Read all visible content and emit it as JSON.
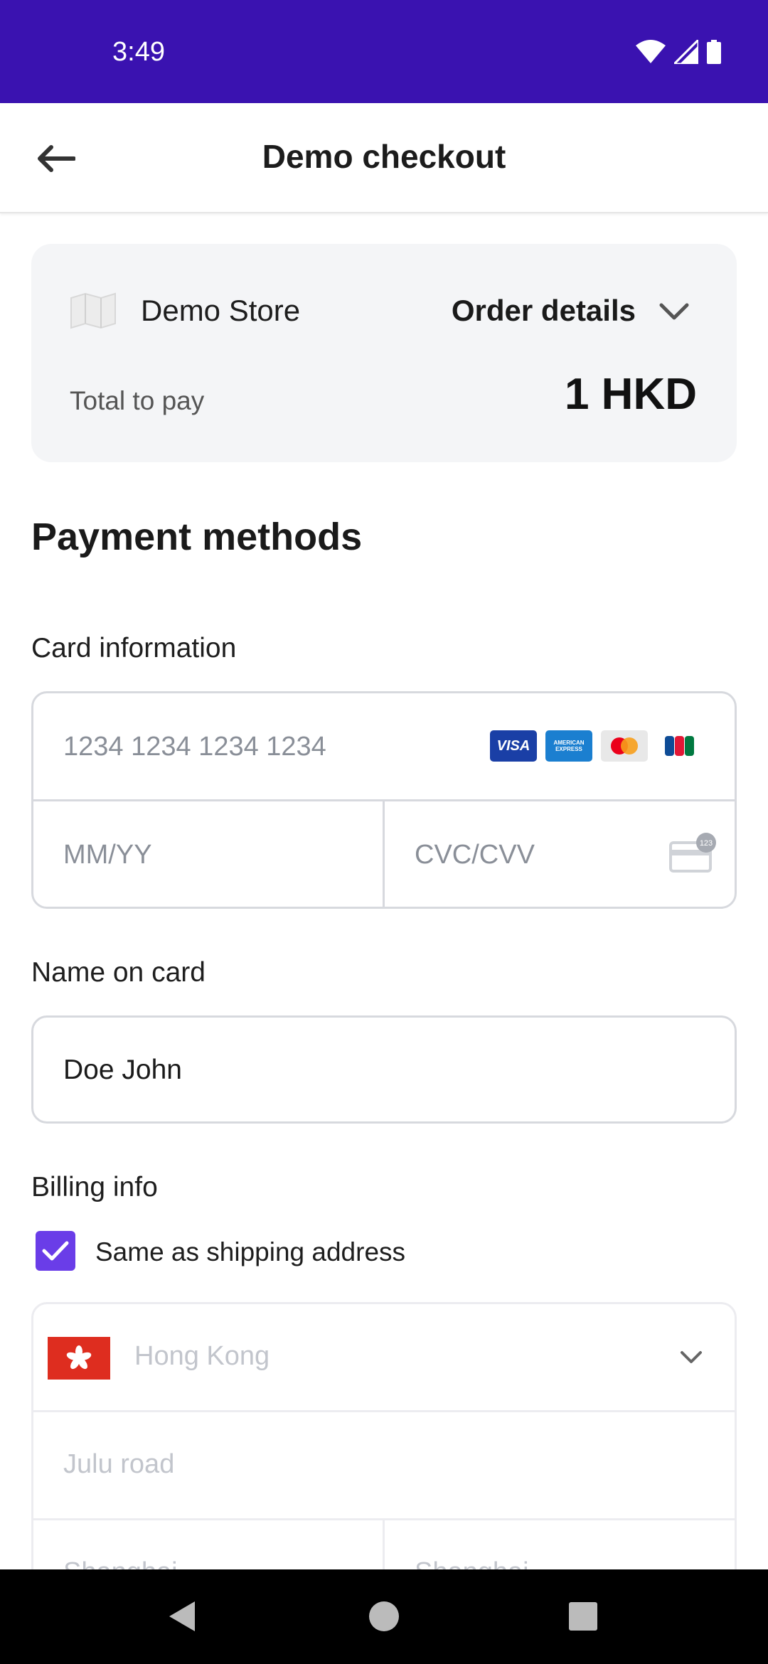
{
  "status_bar": {
    "time": "3:49"
  },
  "app_bar": {
    "title": "Demo checkout"
  },
  "order": {
    "store_name": "Demo Store",
    "details_label": "Order details",
    "total_label": "Total to pay",
    "total_amount": "1 HKD"
  },
  "payment": {
    "section_title": "Payment methods",
    "card_label": "Card information",
    "card_number_placeholder": "1234 1234 1234 1234",
    "expiry_placeholder": "MM/YY",
    "cvc_placeholder": "CVC/CVV",
    "brands": [
      "VISA",
      "AMERICAN EXPRESS",
      "Mastercard",
      "JCB"
    ],
    "cvc_badge": "123",
    "name_label": "Name on card",
    "name_value": "Doe John"
  },
  "billing": {
    "label": "Billing info",
    "same_as_shipping": "Same as shipping address",
    "same_as_shipping_checked": true,
    "country": "Hong Kong",
    "street": "Julu road",
    "city_partial": "Shanghai",
    "state_partial": "Shanghai"
  },
  "colors": {
    "status_bar": "#3a12b0",
    "accent": "#6a3de8",
    "card_bg": "#f4f5f7",
    "flag_red": "#de2d1f"
  }
}
